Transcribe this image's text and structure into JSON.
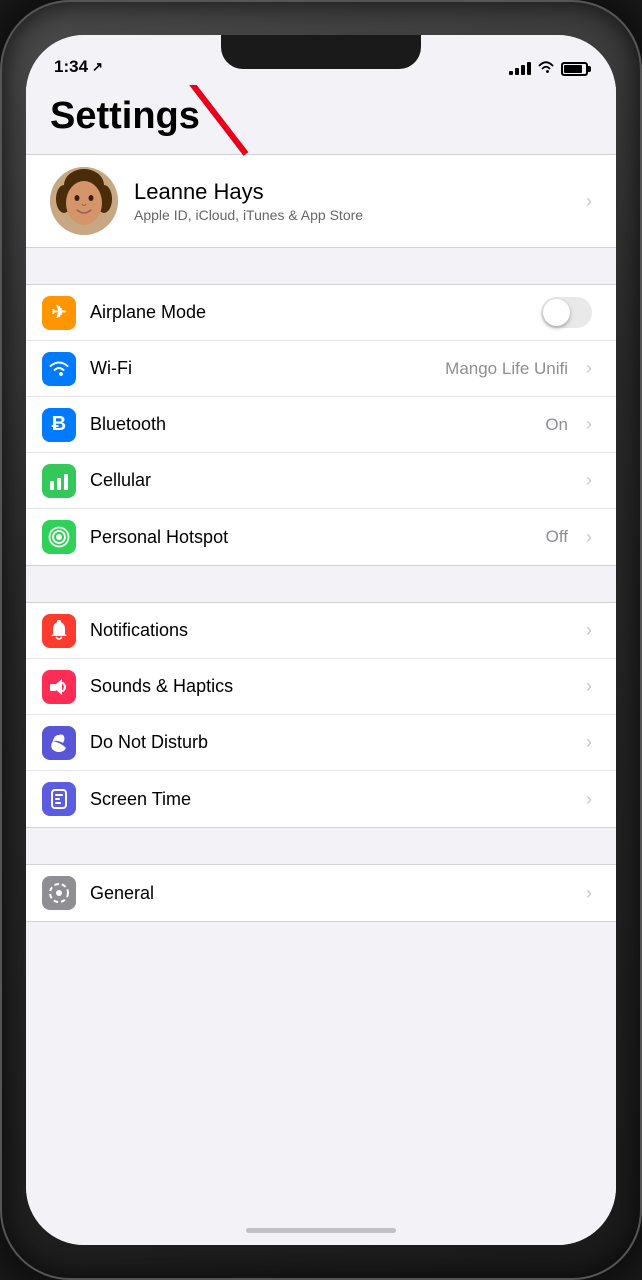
{
  "statusBar": {
    "time": "1:34",
    "locationIcon": "↗",
    "signalBars": [
      4,
      7,
      10,
      13
    ],
    "wifiLabel": "wifi",
    "batteryLevel": 85
  },
  "title": "Settings",
  "profile": {
    "name": "Leanne Hays",
    "subtitle": "Apple ID, iCloud, iTunes & App Store"
  },
  "connectivity": [
    {
      "id": "airplane-mode",
      "label": "Airplane Mode",
      "iconColor": "orange",
      "iconSymbol": "✈",
      "value": "",
      "hasToggle": true,
      "toggleOn": false
    },
    {
      "id": "wifi",
      "label": "Wi-Fi",
      "iconColor": "blue",
      "iconSymbol": "wifi",
      "value": "Mango Life Unifi",
      "hasToggle": false
    },
    {
      "id": "bluetooth",
      "label": "Bluetooth",
      "iconColor": "blue-dark",
      "iconSymbol": "bt",
      "value": "On",
      "hasToggle": false
    },
    {
      "id": "cellular",
      "label": "Cellular",
      "iconColor": "green-bright",
      "iconSymbol": "cell",
      "value": "",
      "hasToggle": false
    },
    {
      "id": "personal-hotspot",
      "label": "Personal Hotspot",
      "iconColor": "green",
      "iconSymbol": "hotspot",
      "value": "Off",
      "hasToggle": false
    }
  ],
  "systemSettings": [
    {
      "id": "notifications",
      "label": "Notifications",
      "iconColor": "red",
      "iconSymbol": "notif"
    },
    {
      "id": "sounds-haptics",
      "label": "Sounds & Haptics",
      "iconColor": "pink",
      "iconSymbol": "sound"
    },
    {
      "id": "do-not-disturb",
      "label": "Do Not Disturb",
      "iconColor": "purple",
      "iconSymbol": "moon"
    },
    {
      "id": "screen-time",
      "label": "Screen Time",
      "iconColor": "indigo",
      "iconSymbol": "hourglass"
    }
  ],
  "generalSettings": [
    {
      "id": "general",
      "label": "General",
      "iconColor": "gray",
      "iconSymbol": "gear"
    }
  ],
  "annotation": {
    "arrowVisible": true
  }
}
